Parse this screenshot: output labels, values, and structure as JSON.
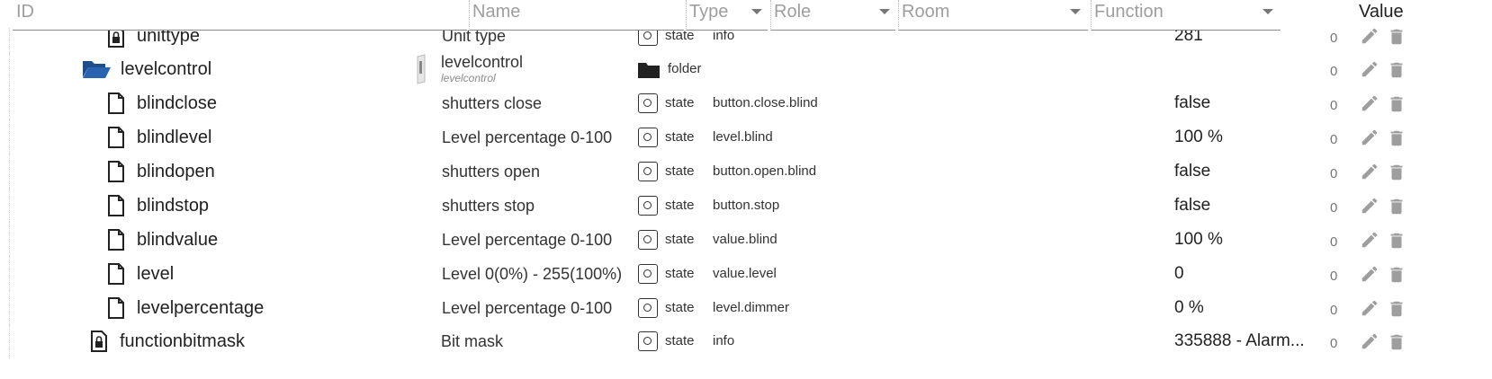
{
  "header": {
    "id": "ID",
    "name": "Name",
    "type": "Type",
    "role": "Role",
    "room": "Room",
    "function": "Function",
    "value": "Value"
  },
  "rows": [
    {
      "id": "unittype",
      "name": "Unit type",
      "type": "state",
      "role": "info",
      "value": "281",
      "count": "0",
      "icon": "lock-file-icon"
    },
    {
      "id": "levelcontrol",
      "name": "levelcontrol",
      "name_sub": "levelcontrol",
      "type": "folder",
      "role": "",
      "value": "",
      "count": "0",
      "icon": "folder-open-icon"
    },
    {
      "id": "blindclose",
      "name": "shutters close",
      "type": "state",
      "role": "button.close.blind",
      "value": "false",
      "count": "0",
      "icon": "file-icon"
    },
    {
      "id": "blindlevel",
      "name": "Level percentage 0-100",
      "type": "state",
      "role": "level.blind",
      "value": "100 %",
      "count": "0",
      "icon": "file-icon"
    },
    {
      "id": "blindopen",
      "name": "shutters open",
      "type": "state",
      "role": "button.open.blind",
      "value": "false",
      "count": "0",
      "icon": "file-icon"
    },
    {
      "id": "blindstop",
      "name": "shutters stop",
      "type": "state",
      "role": "button.stop",
      "value": "false",
      "count": "0",
      "icon": "file-icon"
    },
    {
      "id": "blindvalue",
      "name": "Level percentage 0-100",
      "type": "state",
      "role": "value.blind",
      "value": "100 %",
      "count": "0",
      "icon": "file-icon"
    },
    {
      "id": "level",
      "name": "Level 0(0%) - 255(100%)",
      "type": "state",
      "role": "value.level",
      "value": "0",
      "count": "0",
      "icon": "file-icon"
    },
    {
      "id": "levelpercentage",
      "name": "Level percentage 0-100",
      "type": "state",
      "role": "level.dimmer",
      "value": "0 %",
      "count": "0",
      "icon": "file-icon"
    },
    {
      "id": "functionbitmask",
      "name": "Bit mask",
      "type": "state",
      "role": "info",
      "value": "335888 - Alarm...",
      "count": "0",
      "icon": "lock-file-icon"
    }
  ]
}
